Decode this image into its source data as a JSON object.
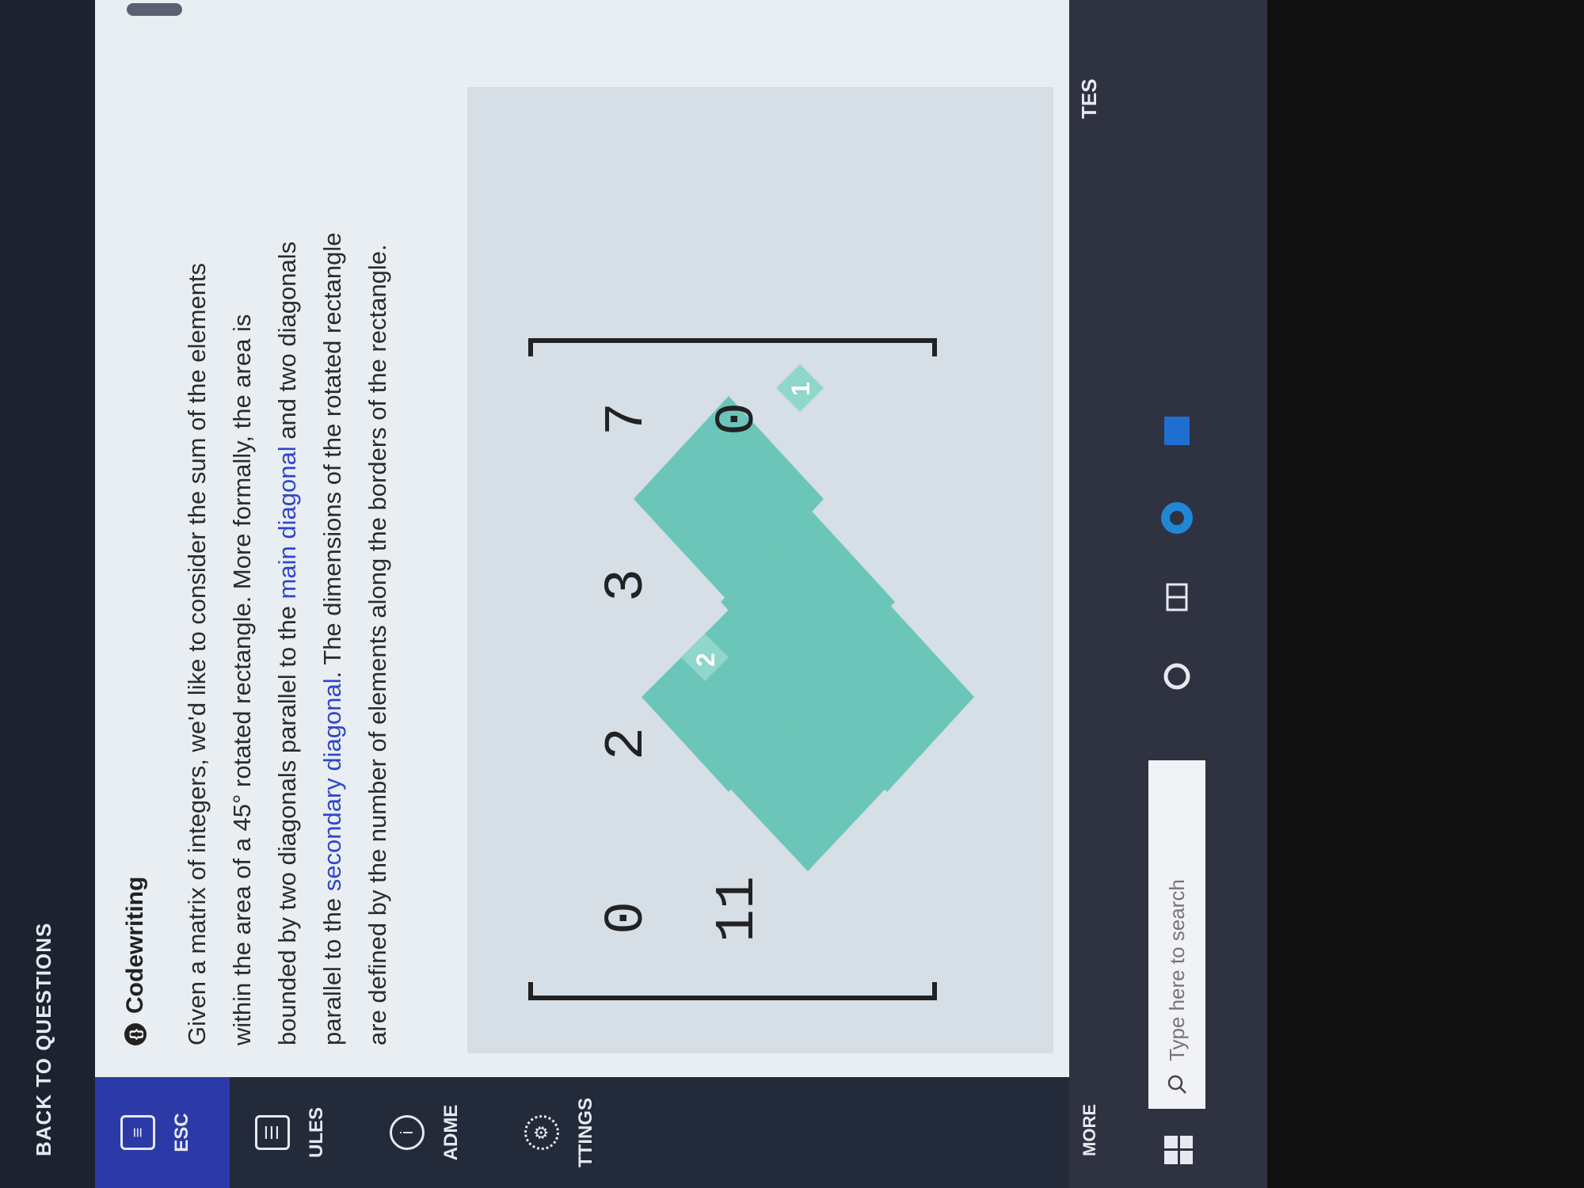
{
  "header": {
    "back_label": "BACK TO QUESTIONS"
  },
  "sidebar": {
    "items": [
      {
        "label": "ESC",
        "icon": "document-icon"
      },
      {
        "label": "ULES",
        "icon": "list-icon"
      },
      {
        "label": "ADME",
        "icon": "info-icon"
      },
      {
        "label": "TTINGS",
        "icon": "gear-icon"
      }
    ]
  },
  "problem": {
    "badge": "Codewriting",
    "text_1": "Given a matrix of integers, we'd like to consider the sum of the elements within the area of a 45° rotated rectangle. More formally, the area is bounded by two diagonals parallel to the ",
    "link_main": "main diagonal",
    "text_2": " and two diagonals parallel to the ",
    "link_secondary": "secondary diagonal",
    "text_3": ". The dimensions of the rotated rectangle are defined by the number of elements along the borders of the rectangle."
  },
  "figure": {
    "row1": [
      "0",
      "2",
      "3",
      "7"
    ],
    "row2": [
      "11",
      "",
      "",
      "0"
    ],
    "dim_a": "2",
    "dim_b": "1",
    "accent": "#6bc6b9"
  },
  "taskbar": {
    "more_label": "MORE",
    "search_placeholder": "Type here to search",
    "tests_label": "TES"
  }
}
